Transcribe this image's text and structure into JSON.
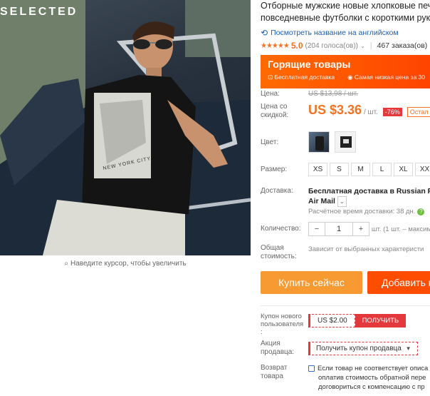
{
  "gallery": {
    "brand": "SELECTED",
    "tshirt_print": "NEW YORK CITY",
    "zoom_hint": "Наведите курсор, чтобы увеличить",
    "zoom_icon": "search-icon"
  },
  "product": {
    "title_line1": "Отборные мужские новые хлопковые печа",
    "title_line2": "повседневные футболки с короткими рука",
    "translate_link": "Посмотреть название на английском",
    "rating_stars": "★★★★★",
    "rating": "5.0",
    "reviews": "(204 голоса(ов))",
    "orders": "467 заказа(ов)"
  },
  "banner": {
    "title": "Горящие товары",
    "sub1": "Бесплатная доставка",
    "sub2": "Самая низкая цена за 30"
  },
  "price": {
    "label": "Цена:",
    "old": "US $13,98 / шт.",
    "discount_label_1": "Цена со",
    "discount_label_2": "скидкой:",
    "new": "US $3.36",
    "unit": "/ шт.",
    "discount": "-76%",
    "left": "Остал"
  },
  "color": {
    "label": "Цвет:"
  },
  "size": {
    "label": "Размер:",
    "options": [
      "XS",
      "S",
      "M",
      "L",
      "XL",
      "XX"
    ]
  },
  "shipping": {
    "label": "Доставка:",
    "line1": "Бесплатная доставка в Russian Fede",
    "line2": "Air Mail",
    "time": "Расчётное время доставки: 38 дн."
  },
  "quantity": {
    "label": "Количество:",
    "minus": "−",
    "value": "1",
    "plus": "+",
    "info": "шт. (1 шт. – максим"
  },
  "total": {
    "label1": "Общая",
    "label2": "стоимость:",
    "value": "Зависит от выбранных характеристи"
  },
  "actions": {
    "buy": "Купить сейчас",
    "cart": "Добавить в"
  },
  "coupon": {
    "label1": "Купон нового",
    "label2": "пользователя",
    "label3": ":",
    "value": "US $2.00",
    "get": "ПОЛУЧИТЬ"
  },
  "seller": {
    "label1": "Акция",
    "label2": "продавца:",
    "button": "Получить купон продавца"
  },
  "returns": {
    "label1": "Возврат",
    "label2": "товара",
    "line1": "Если товар не соответствует описа",
    "line2": "оплатив стоимость обратной пере",
    "line3": "договориться с компенсацию с пр"
  },
  "colors": {
    "accent": "#f57224",
    "banner": "#ff5a00",
    "red": "#e4393c",
    "link": "#1a5fb4",
    "buy": "#f79a32",
    "cart": "#ff4d00"
  }
}
